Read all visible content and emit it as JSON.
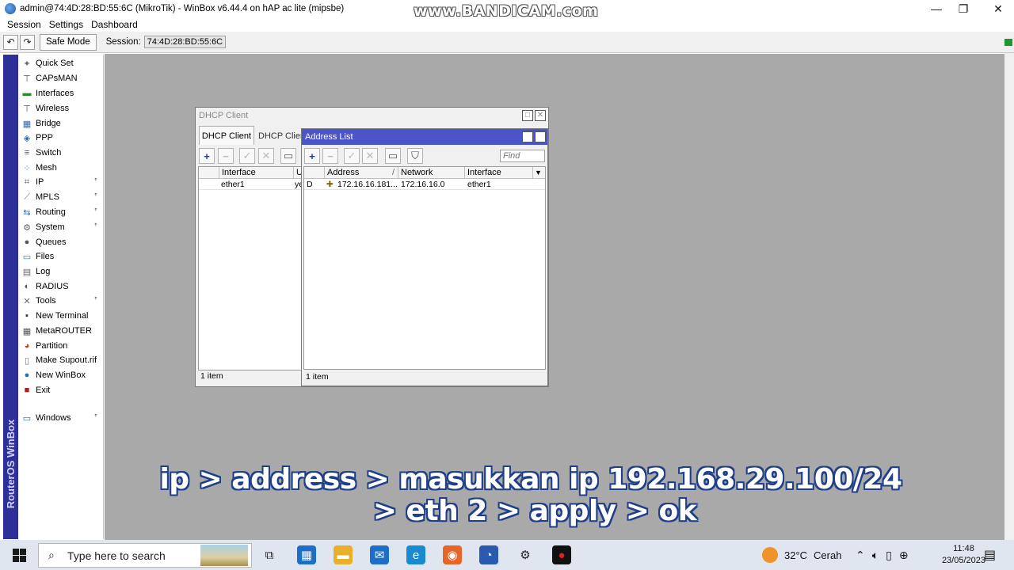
{
  "window": {
    "title": "admin@74:4D:28:BD:55:6C (MikroTik) - WinBox v6.44.4 on hAP ac lite (mipsbe)",
    "watermark": "www.BANDICAM.com",
    "minimize": "—",
    "maximize": "❐",
    "close": "✕"
  },
  "menu": [
    "Session",
    "Settings",
    "Dashboard"
  ],
  "toolbar": {
    "undo_icon": "↶",
    "redo_icon": "↷",
    "safe_mode": "Safe Mode",
    "session_label": "Session:",
    "session_value": "74:4D:28:BD:55:6C"
  },
  "sidebar": {
    "brand": "RouterOS WinBox",
    "items": [
      {
        "label": "Quick Set",
        "icon": "quick-set-icon",
        "glyph": "✦",
        "color": "#6a6a6a",
        "sub": false
      },
      {
        "label": "CAPsMAN",
        "icon": "capsman-icon",
        "glyph": "⊤",
        "color": "#555555",
        "sub": false
      },
      {
        "label": "Interfaces",
        "icon": "interfaces-icon",
        "glyph": "▬",
        "color": "#2a8a2a",
        "sub": false
      },
      {
        "label": "Wireless",
        "icon": "wireless-icon",
        "glyph": "⊤",
        "color": "#555555",
        "sub": false
      },
      {
        "label": "Bridge",
        "icon": "bridge-icon",
        "glyph": "▦",
        "color": "#2a6ab0",
        "sub": false
      },
      {
        "label": "PPP",
        "icon": "ppp-icon",
        "glyph": "◈",
        "color": "#2a6ab0",
        "sub": false
      },
      {
        "label": "Switch",
        "icon": "switch-icon",
        "glyph": "≡",
        "color": "#555555",
        "sub": false
      },
      {
        "label": "Mesh",
        "icon": "mesh-icon",
        "glyph": "⁘",
        "color": "#2a6ab0",
        "sub": false
      },
      {
        "label": "IP",
        "icon": "ip-icon",
        "glyph": "⌗",
        "color": "#555555",
        "sub": true
      },
      {
        "label": "MPLS",
        "icon": "mpls-icon",
        "glyph": "⟋",
        "color": "#777777",
        "sub": true
      },
      {
        "label": "Routing",
        "icon": "routing-icon",
        "glyph": "⇆",
        "color": "#2a6ab0",
        "sub": true
      },
      {
        "label": "System",
        "icon": "system-icon",
        "glyph": "⚙",
        "color": "#666666",
        "sub": true
      },
      {
        "label": "Queues",
        "icon": "queues-icon",
        "glyph": "●",
        "color": "#555555",
        "sub": false
      },
      {
        "label": "Files",
        "icon": "files-icon",
        "glyph": "▭",
        "color": "#3a7ac0",
        "sub": false
      },
      {
        "label": "Log",
        "icon": "log-icon",
        "glyph": "▤",
        "color": "#666666",
        "sub": false
      },
      {
        "label": "RADIUS",
        "icon": "radius-icon",
        "glyph": "◐",
        "color": "#555555",
        "sub": false
      },
      {
        "label": "Tools",
        "icon": "tools-icon",
        "glyph": "✕",
        "color": "#666666",
        "sub": true
      },
      {
        "label": "New Terminal",
        "icon": "terminal-icon",
        "glyph": "▪",
        "color": "#333333",
        "sub": false
      },
      {
        "label": "MetaROUTER",
        "icon": "metarouter-icon",
        "glyph": "▦",
        "color": "#555555",
        "sub": false
      },
      {
        "label": "Partition",
        "icon": "partition-icon",
        "glyph": "◕",
        "color": "#c04020",
        "sub": false
      },
      {
        "label": "Make Supout.rif",
        "icon": "supout-icon",
        "glyph": "▯",
        "color": "#777777",
        "sub": false
      },
      {
        "label": "New WinBox",
        "icon": "new-winbox-icon",
        "glyph": "●",
        "color": "#2a6ab0",
        "sub": false
      },
      {
        "label": "Exit",
        "icon": "exit-icon",
        "glyph": "■",
        "color": "#aa2020",
        "sub": false
      }
    ],
    "windows_item": {
      "label": "Windows",
      "icon": "windows-menu-icon",
      "glyph": "▭",
      "color": "#2a6ab0",
      "sub": true
    },
    "sub_arrow": "ꜛ"
  },
  "dhcp_client": {
    "title": "DHCP Client",
    "tabs": [
      "DHCP Client",
      "DHCP Client Options"
    ],
    "columns": [
      "Interface",
      "U"
    ],
    "rows": [
      {
        "interface": "ether1",
        "use": "ye"
      }
    ],
    "status": "1 item",
    "add": "+",
    "remove": "−",
    "enable": "✓",
    "disable": "✕",
    "comment": "▭"
  },
  "address_list": {
    "title": "Address List",
    "find_placeholder": "Find",
    "columns": [
      "Address",
      "Network",
      "Interface"
    ],
    "rows": [
      {
        "flag": "D",
        "address": "172.16.16.181...",
        "network": "172.16.16.0",
        "interface": "ether1"
      }
    ],
    "status": "1 item",
    "add": "+",
    "remove": "−",
    "enable": "✓",
    "disable": "✕",
    "comment": "▭",
    "filter": "⛉",
    "sort": "/",
    "dropdown": "▼"
  },
  "subtitle": {
    "line1": "ip > address > masukkan ip 192.168.29.100/24",
    "line2": "> eth 2 > apply > ok"
  },
  "taskbar": {
    "search_placeholder": "Type here to search",
    "weather_temp": "32°C",
    "weather_text": "Cerah",
    "time": "11:48",
    "date": "23/05/2023",
    "apps": [
      {
        "name": "task-view-icon",
        "glyph": "⧉",
        "color": "#dfe6ef",
        "fg": "#222"
      },
      {
        "name": "microsoft-store-icon",
        "glyph": "▦",
        "color": "#1e6ec8",
        "fg": "#fff"
      },
      {
        "name": "file-explorer-icon",
        "glyph": "▬",
        "color": "#e8b02a",
        "fg": "#fff"
      },
      {
        "name": "mail-icon",
        "glyph": "✉",
        "color": "#1e6ec8",
        "fg": "#fff"
      },
      {
        "name": "edge-icon",
        "glyph": "e",
        "color": "#1a8ad0",
        "fg": "#fff"
      },
      {
        "name": "firefox-icon",
        "glyph": "◉",
        "color": "#e8652a",
        "fg": "#fff"
      },
      {
        "name": "winbox-taskbar-icon",
        "glyph": "◔",
        "color": "#2a5ab0",
        "fg": "#fff"
      },
      {
        "name": "settings-icon",
        "glyph": "⚙",
        "color": "#dfe6ef",
        "fg": "#222"
      },
      {
        "name": "bandicam-icon",
        "glyph": "●",
        "color": "#111111",
        "fg": "#e02020"
      }
    ]
  }
}
